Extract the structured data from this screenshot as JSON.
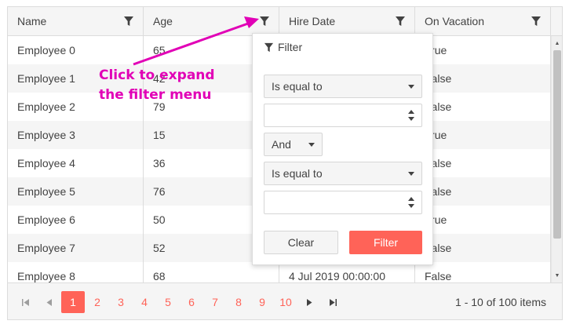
{
  "columns": [
    {
      "label": "Name",
      "filter_icon": "funnel-icon"
    },
    {
      "label": "Age",
      "filter_icon": "funnel-icon"
    },
    {
      "label": "Hire Date",
      "filter_icon": "funnel-icon"
    },
    {
      "label": "On Vacation",
      "filter_icon": "funnel-icon"
    }
  ],
  "rows": [
    {
      "name": "Employee 0",
      "age": "65",
      "hire": "",
      "vacation": "True"
    },
    {
      "name": "Employee 1",
      "age": "42",
      "hire": "",
      "vacation": "False"
    },
    {
      "name": "Employee 2",
      "age": "79",
      "hire": "",
      "vacation": "False"
    },
    {
      "name": "Employee 3",
      "age": "15",
      "hire": "",
      "vacation": "True"
    },
    {
      "name": "Employee 4",
      "age": "36",
      "hire": "",
      "vacation": "False"
    },
    {
      "name": "Employee 5",
      "age": "76",
      "hire": "",
      "vacation": "False"
    },
    {
      "name": "Employee 6",
      "age": "50",
      "hire": "",
      "vacation": "True"
    },
    {
      "name": "Employee 7",
      "age": "52",
      "hire": "",
      "vacation": "False"
    },
    {
      "name": "Employee 8",
      "age": "68",
      "hire": "4 Jul 2019 00:00:00",
      "vacation": "False"
    }
  ],
  "filter_menu": {
    "title": "Filter",
    "operator_1": "Is equal to",
    "value_1": "",
    "logic": "And",
    "operator_2": "Is equal to",
    "value_2": "",
    "clear_label": "Clear",
    "filter_label": "Filter"
  },
  "pager": {
    "first_icon": "first-page-icon",
    "prev_icon": "prev-page-icon",
    "pages": [
      "1",
      "2",
      "3",
      "4",
      "5",
      "6",
      "7",
      "8",
      "9",
      "10"
    ],
    "current_page": "1",
    "next_icon": "next-page-icon",
    "last_icon": "last-page-icon",
    "info": "1 - 10 of 100 items"
  },
  "annotation": {
    "line1": "Click to expand",
    "line2": "the filter menu"
  },
  "colors": {
    "accent": "#ff6358",
    "annotation": "#e100b6",
    "header_bg": "#f5f5f5",
    "border": "#dcdcdc"
  }
}
